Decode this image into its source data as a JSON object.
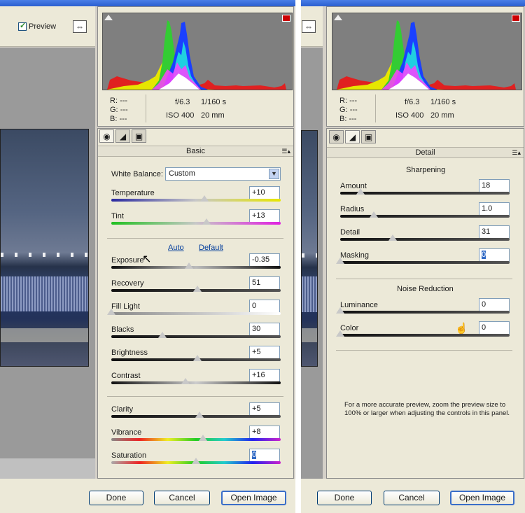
{
  "left_window": {
    "toolbar": {
      "preview_label": "Preview"
    },
    "histogram": {
      "r": "R:",
      "g": "G:",
      "b": "B:",
      "r_val": "---",
      "g_val": "---",
      "b_val": "---",
      "aperture": "f/6.3",
      "shutter": "1/160 s",
      "iso": "ISO 400",
      "focal": "20 mm"
    },
    "panel_title": "Basic",
    "white_balance": {
      "label": "White Balance:",
      "value": "Custom"
    },
    "auto": "Auto",
    "default": "Default",
    "sliders": [
      {
        "label": "Temperature",
        "value": "+10",
        "level": 0.55
      },
      {
        "label": "Tint",
        "value": "+13",
        "level": 0.56
      },
      {
        "label": "Exposure",
        "value": "-0.35",
        "level": 0.46
      },
      {
        "label": "Recovery",
        "value": "51",
        "level": 0.51
      },
      {
        "label": "Fill Light",
        "value": "0",
        "level": 0.0
      },
      {
        "label": "Blacks",
        "value": "30",
        "level": 0.3
      },
      {
        "label": "Brightness",
        "value": "+5",
        "level": 0.51
      },
      {
        "label": "Contrast",
        "value": "+16",
        "level": 0.44
      },
      {
        "label": "Clarity",
        "value": "+5",
        "level": 0.52
      },
      {
        "label": "Vibrance",
        "value": "+8",
        "level": 0.54
      },
      {
        "label": "Saturation",
        "value": "0",
        "level": 0.5
      }
    ],
    "buttons": {
      "done": "Done",
      "cancel": "Cancel",
      "open": "Open Image"
    }
  },
  "right_window": {
    "histogram": {
      "r": "R:",
      "g": "G:",
      "b": "B:",
      "r_val": "---",
      "g_val": "---",
      "b_val": "---",
      "aperture": "f/6.3",
      "shutter": "1/160 s",
      "iso": "ISO 400",
      "focal": "20 mm"
    },
    "panel_title": "Detail",
    "sharpening_title": "Sharpening",
    "noise_title": "Noise Reduction",
    "sliders": [
      {
        "label": "Amount",
        "value": "18",
        "level": 0.12
      },
      {
        "label": "Radius",
        "value": "1.0",
        "level": 0.2
      },
      {
        "label": "Detail",
        "value": "31",
        "level": 0.31
      },
      {
        "label": "Masking",
        "value": "0",
        "level": 0.0
      },
      {
        "label": "Luminance",
        "value": "0",
        "level": 0.0
      },
      {
        "label": "Color",
        "value": "0",
        "level": 0.0
      }
    ],
    "note": "For a more accurate preview, zoom the preview size to 100% or larger when adjusting the controls in this panel.",
    "buttons": {
      "done": "Done",
      "cancel": "Cancel",
      "open": "Open Image"
    }
  }
}
